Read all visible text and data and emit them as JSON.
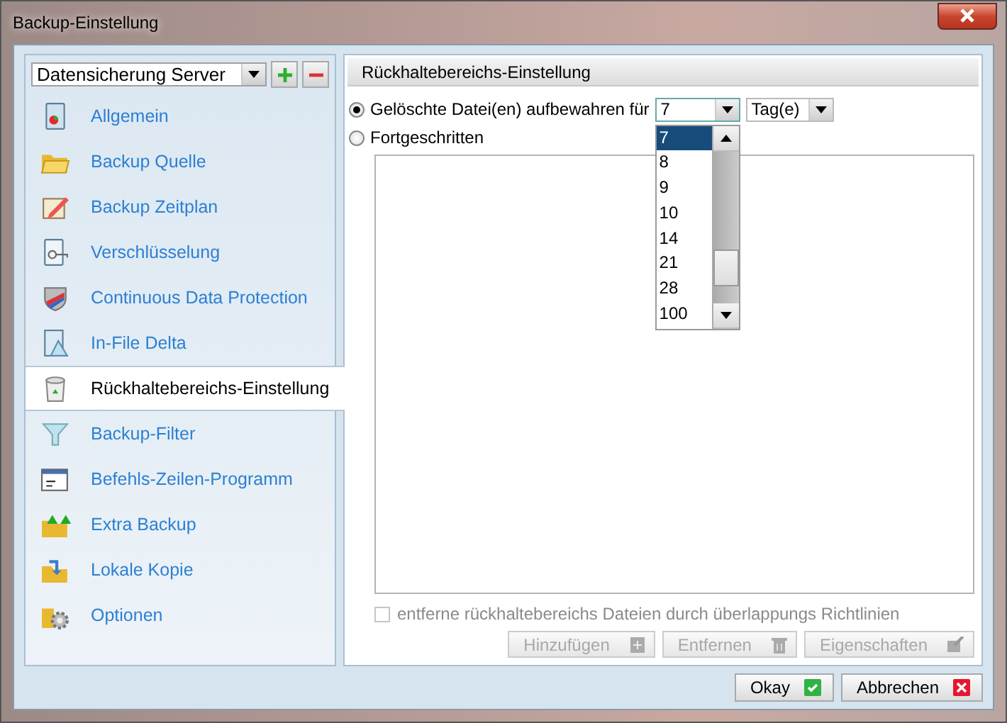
{
  "window": {
    "title": "Backup-Einstellung"
  },
  "sidebar": {
    "profile": {
      "value": "Datensicherung Server"
    },
    "items": [
      {
        "label": "Allgemein",
        "selected": false
      },
      {
        "label": "Backup Quelle",
        "selected": false
      },
      {
        "label": "Backup Zeitplan",
        "selected": false
      },
      {
        "label": "Verschlüsselung",
        "selected": false
      },
      {
        "label": "Continuous Data Protection",
        "selected": false
      },
      {
        "label": "In-File Delta",
        "selected": false
      },
      {
        "label": "Rückhaltebereichs-Einstellung",
        "selected": true
      },
      {
        "label": "Backup-Filter",
        "selected": false
      },
      {
        "label": "Befehls-Zeilen-Programm",
        "selected": false
      },
      {
        "label": "Extra Backup",
        "selected": false
      },
      {
        "label": "Lokale Kopie",
        "selected": false
      },
      {
        "label": "Optionen",
        "selected": false
      }
    ]
  },
  "panel": {
    "title": "Rückhaltebereichs-Einstellung",
    "options": [
      {
        "label": "Gelöschte Datei(en) aufbewahren für",
        "selected": true
      },
      {
        "label": "Fortgeschritten",
        "selected": false
      }
    ],
    "days": {
      "value": "7",
      "expanded": true,
      "options": [
        {
          "label": "7",
          "selected": true
        },
        {
          "label": "8",
          "selected": false
        },
        {
          "label": "9",
          "selected": false
        },
        {
          "label": "10",
          "selected": false
        },
        {
          "label": "14",
          "selected": false
        },
        {
          "label": "21",
          "selected": false
        },
        {
          "label": "28",
          "selected": false
        },
        {
          "label": "100",
          "selected": false
        }
      ]
    },
    "unit": {
      "value": "Tag(e)"
    },
    "checkbox": {
      "label": "entferne rückhaltebereichs Dateien durch überlappungs Richtlinien",
      "checked": false,
      "disabled": true
    },
    "buttons": [
      {
        "label": "Hinzufügen",
        "disabled": true
      },
      {
        "label": "Entfernen",
        "disabled": true
      },
      {
        "label": "Eigenschaften",
        "disabled": true
      }
    ]
  },
  "buttons": [
    {
      "label": "Okay",
      "kind": "ok"
    },
    {
      "label": "Abbrechen",
      "kind": "cancel"
    }
  ]
}
